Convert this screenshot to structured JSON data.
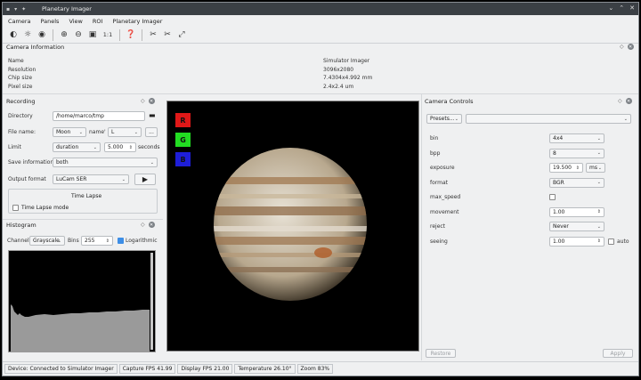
{
  "window": {
    "title": "Planetary Imager"
  },
  "menu": [
    "Camera",
    "Panels",
    "View",
    "ROI",
    "Planetary Imager"
  ],
  "toolbar": {
    "zoom_label": "1:1"
  },
  "camera_info": {
    "title": "Camera Information",
    "rows": [
      {
        "label": "Name",
        "value": "Simulator Imager"
      },
      {
        "label": "Resolution",
        "value": "3096x2080"
      },
      {
        "label": "Chip size",
        "value": "7.4304x4.992 mm"
      },
      {
        "label": "Pixel size",
        "value": "2.4x2.4 um"
      }
    ]
  },
  "recording": {
    "title": "Recording",
    "directory_label": "Directory",
    "directory_value": "/home/marco/tmp",
    "filename_label": "File name:",
    "filename_prefix": "Moon",
    "name_label": "name'",
    "filename_suffix": "L",
    "more_button": "...",
    "limit_label": "Limit",
    "limit_type": "duration",
    "limit_value": "5.000",
    "limit_unit": "seconds",
    "save_info_label": "Save information",
    "save_info_value": "both",
    "output_label": "Output format",
    "output_value": "LuCam SER",
    "timelapse_title": "Time Lapse",
    "timelapse_mode": "Time Lapse mode"
  },
  "histogram": {
    "title": "Histogram",
    "channel_label": "Channel",
    "channel_value": "Grayscale",
    "bins_label": "Bins",
    "bins_value": "255",
    "log_label": "Logarithmic",
    "log_checked": true
  },
  "channels": {
    "r": "R",
    "g": "G",
    "b": "B",
    "r_color": "#e01818",
    "g_color": "#22dd22",
    "b_color": "#1e1ed8"
  },
  "controls": {
    "title": "Camera Controls",
    "presets_label": "Presets...",
    "rows": [
      {
        "label": "bin",
        "value": "4x4",
        "kind": "combo"
      },
      {
        "label": "bpp",
        "value": "8",
        "kind": "combo"
      },
      {
        "label": "exposure",
        "value": "19.500",
        "unit": "ms",
        "kind": "spinunit"
      },
      {
        "label": "format",
        "value": "BGR",
        "kind": "combo"
      },
      {
        "label": "max_speed",
        "value": "",
        "kind": "check"
      },
      {
        "label": "movement",
        "value": "1.00",
        "kind": "spin"
      },
      {
        "label": "reject",
        "value": "Never",
        "kind": "combo"
      },
      {
        "label": "seeing",
        "value": "1.00",
        "kind": "spinauto",
        "extra": "auto"
      }
    ],
    "restore_label": "Restore",
    "apply_label": "Apply"
  },
  "status": {
    "device": "Device: Connected to Simulator Imager",
    "capture_fps": "Capture FPS 41.99",
    "display_fps": "Display FPS 21.00",
    "temperature": "Temperature  26.10°",
    "zoom": "Zoom  83%"
  }
}
